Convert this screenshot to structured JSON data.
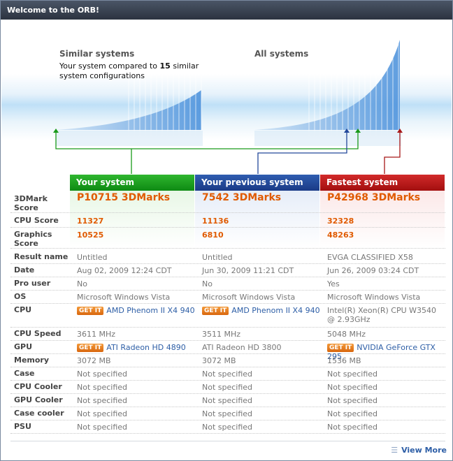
{
  "window": {
    "title": "Welcome to the ORB!"
  },
  "graphs": {
    "similar": {
      "title": "Similar systems",
      "desc_prefix": "Your system compared to",
      "count": "15",
      "desc_suffix": "similar",
      "desc_line2": "system configurations"
    },
    "all": {
      "title": "All systems"
    }
  },
  "columns": [
    {
      "name": "Your system",
      "color": "#0e8a13"
    },
    {
      "name": "Your previous system",
      "color": "#1a3a86"
    },
    {
      "name": "Fastest system",
      "color": "#a20f0f"
    }
  ],
  "rows": {
    "mark": {
      "label": "3DMark Score",
      "v": [
        "P10715 3DMarks",
        "7542 3DMarks",
        "P42968 3DMarks"
      ]
    },
    "cpu_score": {
      "label": "CPU Score",
      "v": [
        "11327",
        "11136",
        "32328"
      ]
    },
    "gfx_score": {
      "label": "Graphics Score",
      "v": [
        "10525",
        "6810",
        "48263"
      ]
    },
    "result": {
      "label": "Result name",
      "v": [
        "Untitled",
        "Untitled",
        "EVGA CLASSIFIED X58"
      ]
    },
    "date": {
      "label": "Date",
      "v": [
        "Aug 02, 2009 12:24 CDT",
        "Jun 30, 2009 11:21 CDT",
        "Jun 26, 2009 03:24 CDT"
      ]
    },
    "pro": {
      "label": "Pro user",
      "v": [
        "No",
        "No",
        "Yes"
      ]
    },
    "os": {
      "label": "OS",
      "v": [
        "Microsoft Windows Vista",
        "Microsoft Windows Vista",
        "Microsoft Windows Vista"
      ]
    },
    "cpu": {
      "label": "CPU",
      "v": [
        "AMD Phenom II X4 940",
        "AMD Phenom II X4 940",
        "Intel(R) Xeon(R) CPU W3540 @ 2.93GHz"
      ]
    },
    "cpu_speed": {
      "label": "CPU Speed",
      "v": [
        "3611 MHz",
        "3511 MHz",
        "5048 MHz"
      ]
    },
    "gpu": {
      "label": "GPU",
      "v": [
        "ATI Radeon HD 4890",
        "ATI Radeon HD 3800",
        "NVIDIA GeForce GTX 295"
      ]
    },
    "memory": {
      "label": "Memory",
      "v": [
        "3072 MB",
        "3072 MB",
        "1536 MB"
      ]
    },
    "case": {
      "label": "Case",
      "v": [
        "Not specified",
        "Not specified",
        "Not specified"
      ]
    },
    "cpu_cooler": {
      "label": "CPU Cooler",
      "v": [
        "Not specified",
        "Not specified",
        "Not specified"
      ]
    },
    "gpu_cooler": {
      "label": "GPU Cooler",
      "v": [
        "Not specified",
        "Not specified",
        "Not specified"
      ]
    },
    "case_cooler": {
      "label": "Case cooler",
      "v": [
        "Not specified",
        "Not specified",
        "Not specified"
      ]
    },
    "psu": {
      "label": "PSU",
      "v": [
        "Not specified",
        "Not specified",
        "Not specified"
      ]
    }
  },
  "getit_label": "GET IT",
  "footer": {
    "view_more": "View More"
  }
}
